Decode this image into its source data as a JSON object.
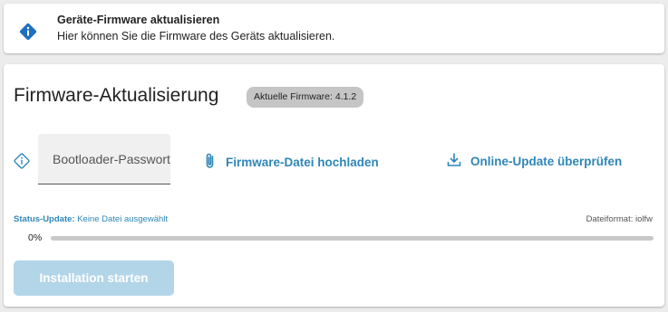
{
  "banner": {
    "title": "Geräte-Firmware aktualisieren",
    "subtitle": "Hier können Sie die Firmware des Geräts aktualisieren."
  },
  "main": {
    "heading": "Firmware-Aktualisierung",
    "firmware_badge": "Aktuelle Firmware: 4.1.2",
    "password_placeholder": "Bootloader-Passwort",
    "upload_label": "Firmware-Datei hochladen",
    "online_update_label": "Online-Update überprüfen",
    "status_label": "Status-Update:",
    "status_value": "Keine Datei ausgewählt",
    "file_format": "Dateiformat: iolfw",
    "progress_text": "0%",
    "progress_value": 0,
    "install_label": "Installation starten"
  },
  "colors": {
    "accent": "#2e86b8",
    "badge": "#c5c5c5",
    "disabled_button": "#b3d5e8",
    "info_icon": "#1f6fc1"
  },
  "icons": {
    "banner": "info-diamond-icon",
    "password_info": "info-diamond-outline-icon",
    "upload": "paperclip-icon",
    "online_update": "download-icon"
  }
}
